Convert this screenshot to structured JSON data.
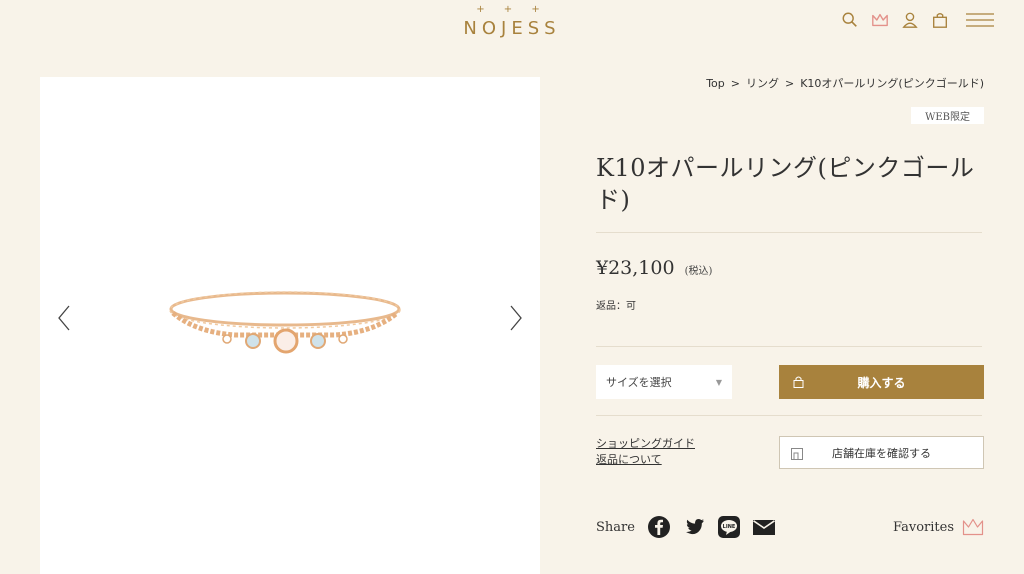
{
  "header": {
    "logo_plus": "+ + +",
    "logo": "NOJESS",
    "icons": [
      "search-icon",
      "crown-icon",
      "user-icon",
      "bag-icon",
      "menu-icon"
    ]
  },
  "breadcrumb": {
    "items": [
      "Top",
      "リング",
      "K10オパールリング(ピンクゴールド)"
    ],
    "separator": ">"
  },
  "product": {
    "badge": "WEB限定",
    "title": "K10オパールリング(ピンクゴールド)",
    "price": "¥23,100",
    "tax": "(税込)",
    "returns": "返品：可",
    "size_select": "サイズを選択",
    "buy_label": "購入する",
    "guide_link": "ショッピングガイド",
    "returns_link": "返品について",
    "store_label": "店舗在庫を確認する"
  },
  "share": {
    "label": "Share",
    "networks": [
      "facebook-icon",
      "twitter-icon",
      "line-icon",
      "mail-icon"
    ],
    "line_text": "LINE"
  },
  "favorites": {
    "label": "Favorites"
  },
  "colors": {
    "background": "#f8f3e9",
    "accent": "#a8823d",
    "crown_pink": "#e3918a",
    "text": "#333333"
  }
}
